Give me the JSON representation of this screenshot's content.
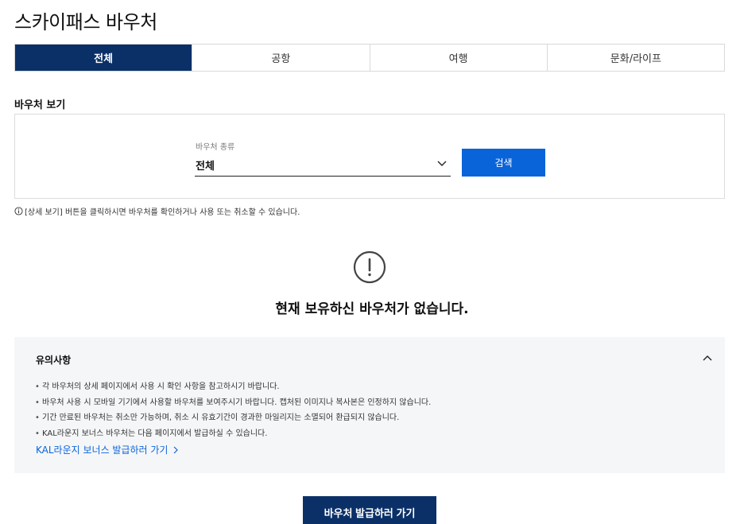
{
  "page": {
    "title": "스카이패스 바우처"
  },
  "tabs": [
    {
      "label": "전체",
      "active": true
    },
    {
      "label": "공항",
      "active": false
    },
    {
      "label": "여행",
      "active": false
    },
    {
      "label": "문화/라이프",
      "active": false
    }
  ],
  "voucher_view": {
    "title": "바우처 보기",
    "type_label": "바우처 종류",
    "type_value": "전체",
    "search_label": "검색",
    "info_icon": "info-circle-icon",
    "info_text": "[상세 보기] 버튼을 클릭하시면 바우처를 확인하거나 사용 또는 취소할 수 있습니다."
  },
  "empty_state": {
    "icon": "exclamation-circle-icon",
    "message": "현재 보유하신 바우처가 없습니다."
  },
  "notice": {
    "title": "유의사항",
    "expanded": true,
    "items": [
      "각 바우처의 상세 페이지에서 사용 시 확인 사항을 참고하시기 바랍니다.",
      "바우처 사용 시 모바일 기기에서 사용할 바우처를 보여주시기 바랍니다. 캡처된 이미지나 복사본은 인정하지 않습니다.",
      "기간 만료된 바우처는 취소만 가능하며, 취소 시 유효기간이 경과한 마일리지는 소멸되어 환급되지 않습니다.",
      "KAL라운지 보너스 바우처는 다음 페이지에서 발급하실 수 있습니다."
    ],
    "link_label": "KAL라운지 보너스 발급하러 가기"
  },
  "issue_button_label": "바우처 발급하러 가기",
  "colors": {
    "navy": "#0a3067",
    "blue": "#0a64d9",
    "notice_bg": "#f5f6f8"
  }
}
